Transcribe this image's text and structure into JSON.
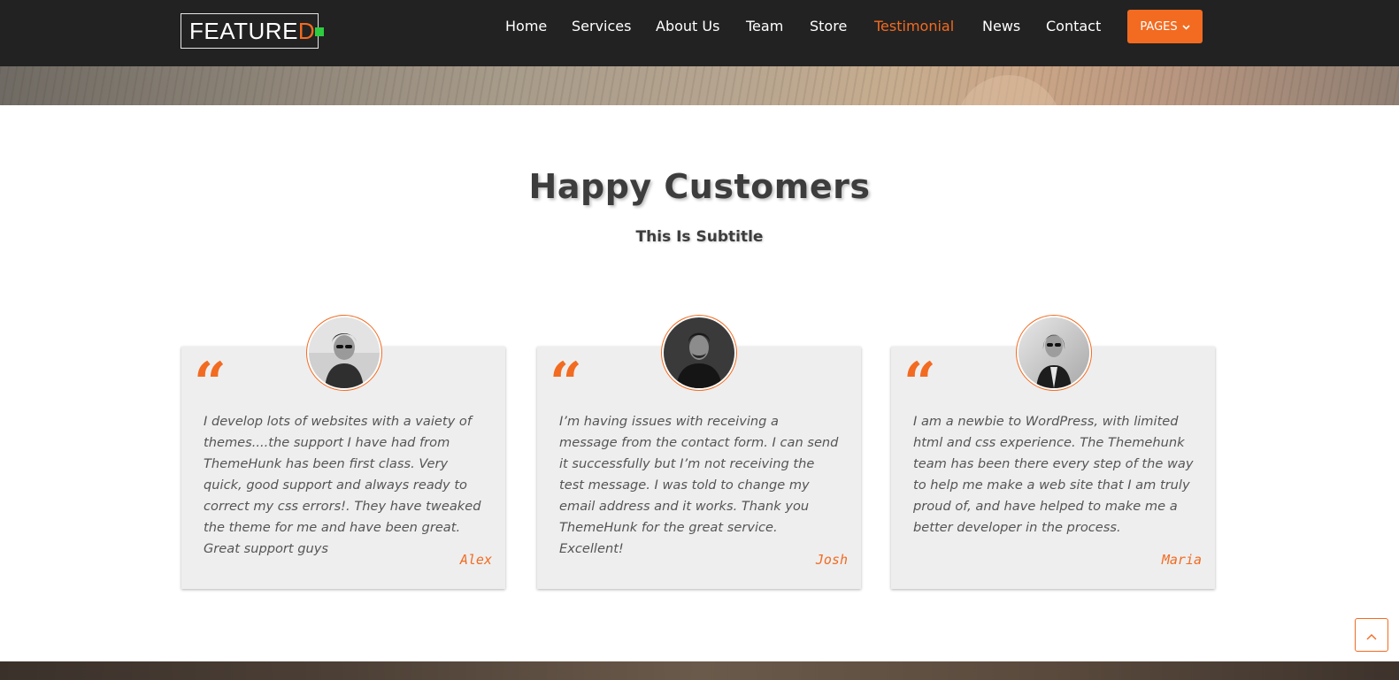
{
  "logo": {
    "text_main": "FEATURE",
    "text_accent": "D"
  },
  "nav": {
    "items": [
      {
        "label": "Home",
        "active": false
      },
      {
        "label": "Services",
        "active": false
      },
      {
        "label": "About Us",
        "active": false
      },
      {
        "label": "Team",
        "active": false
      },
      {
        "label": "Store",
        "active": false
      },
      {
        "label": "Testimonial",
        "active": true
      },
      {
        "label": "News",
        "active": false
      },
      {
        "label": "Contact",
        "active": false
      }
    ],
    "pages_button": "PAGES",
    "pages_icon": "chevron-down-icon"
  },
  "section": {
    "title": "Happy Customers",
    "subtitle": "This Is Subtitle"
  },
  "testimonials": [
    {
      "text": "I develop lots of websites with a vaiety of themes....the support I have had from ThemeHunk has been first class. Very quick, good support and always ready to correct my css errors!. They have tweaked the theme for me and have been great. Great support guys",
      "author": "Alex"
    },
    {
      "text": "I’m having issues with receiving a message from the contact form. I can send it successfully but I’m not receiving the test message. I was told to change my email address and it works. Thank you ThemeHunk for the great service. Excellent!",
      "author": "Josh"
    },
    {
      "text": "I am a newbie to WordPress, with limited html and css experience. The Themehunk team has been there every step of the way to help me make a web site that I am truly proud of, and have helped to make me a better developer in the process.",
      "author": "Maria"
    }
  ],
  "quote_icon": "quote-icon",
  "scroll_top_icon": "chevron-up-icon",
  "colors": {
    "accent": "#f26b21",
    "header_bg": "#222222",
    "card_bg": "#eeeeee",
    "logo_square": "#2ecc40"
  }
}
